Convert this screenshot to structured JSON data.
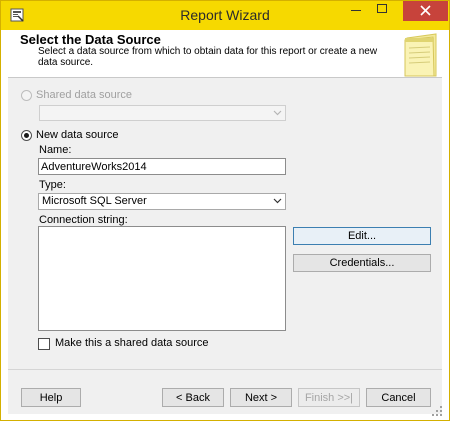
{
  "window": {
    "title": "Report Wizard"
  },
  "header": {
    "title": "Select the Data Source",
    "description": "Select a data source from which to obtain data for this report or create a new data source."
  },
  "shared_source": {
    "label": "Shared data source",
    "selected": false,
    "enabled": false,
    "value": ""
  },
  "new_source": {
    "label": "New data source",
    "selected": true,
    "name_label": "Name:",
    "name_value": "AdventureWorks2014",
    "type_label": "Type:",
    "type_value": "Microsoft SQL Server",
    "connection_label": "Connection string:",
    "connection_value": ""
  },
  "buttons": {
    "edit": "Edit...",
    "credentials": "Credentials...",
    "help": "Help",
    "back": "< Back",
    "next": "Next >",
    "finish": "Finish >>|",
    "cancel": "Cancel"
  },
  "shared_checkbox": {
    "label": "Make this a shared data source",
    "checked": false
  },
  "colors": {
    "titlebar": "#f6d900",
    "close_button": "#c7433b",
    "focused_border": "#3c7fb1"
  },
  "icons": {
    "app": "report-wizard-icon",
    "header": "notepad-icon"
  }
}
